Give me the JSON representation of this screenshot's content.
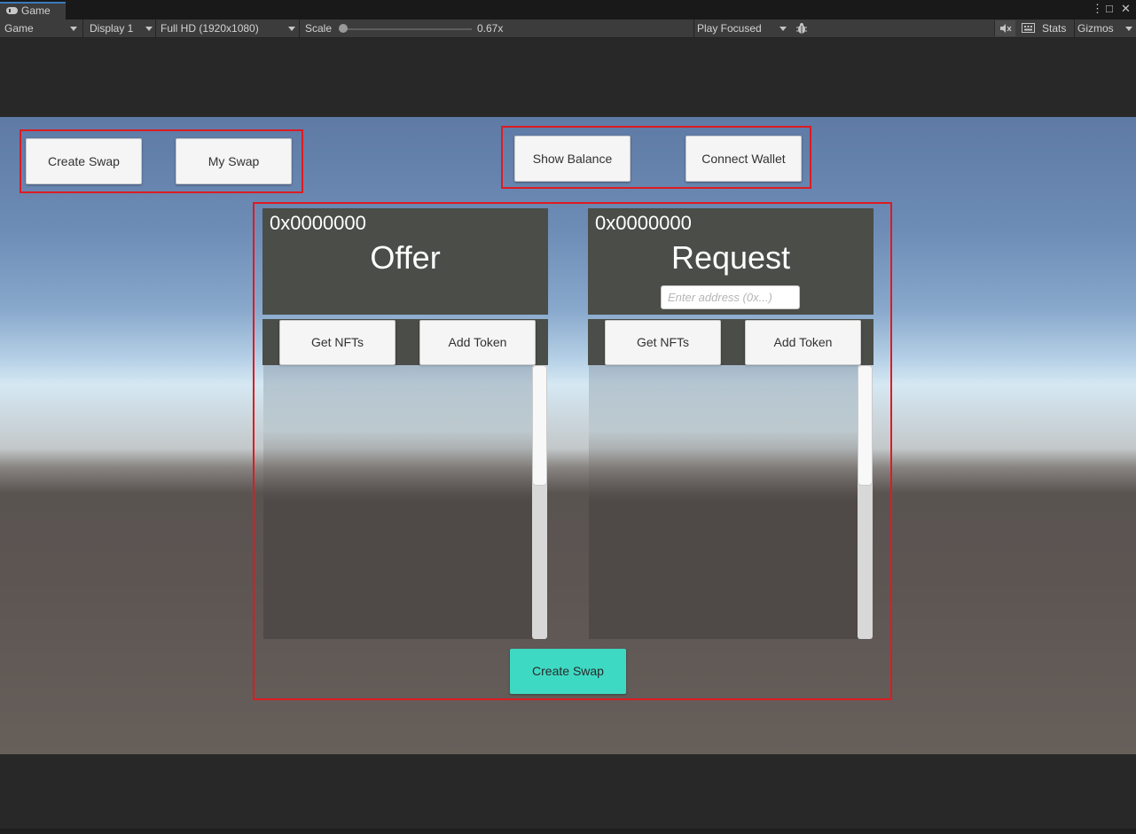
{
  "editor": {
    "tab_label": "Game",
    "win_controls": {
      "more": "⋮",
      "maximize": "□",
      "close": "✕"
    },
    "toolbar": {
      "view_mode": "Game",
      "display": "Display 1",
      "resolution": "Full HD (1920x1080)",
      "scale_label": "Scale",
      "scale_value": "0.67x",
      "scale_fraction": 0,
      "play_mode": "Play Focused",
      "stats": "Stats",
      "gizmos": "Gizmos"
    },
    "icons": {
      "game_tab": "gamepad-icon",
      "debug": "bug-icon",
      "mute": "mute-audio-icon",
      "shortcuts": "keyboard-icon"
    }
  },
  "game": {
    "top_left": {
      "create_swap": "Create Swap",
      "my_swap": "My Swap"
    },
    "top_right": {
      "show_balance": "Show Balance",
      "connect_wallet": "Connect Wallet"
    },
    "offer": {
      "address": "0x0000000",
      "title": "Offer",
      "get_nfts": "Get NFTs",
      "add_token": "Add Token"
    },
    "request": {
      "address": "0x0000000",
      "title": "Request",
      "address_placeholder": "Enter address (0x...)",
      "get_nfts": "Get NFTs",
      "add_token": "Add Token"
    },
    "create_swap_button": "Create Swap",
    "colors": {
      "highlight_border": "#dd1b22",
      "panel": "#4b4d48",
      "accent_button": "#3ed9c3"
    }
  }
}
